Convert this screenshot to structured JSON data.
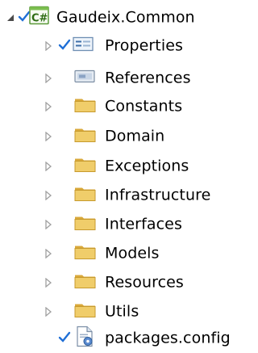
{
  "tree": {
    "project": {
      "name": "Gaudeix.Common",
      "expanded": true,
      "icon": "csharp-project-icon",
      "source_control": "checked-in"
    },
    "items": [
      {
        "label": "Properties",
        "icon": "properties-icon",
        "expandable": true,
        "source_control": "checked-in"
      },
      {
        "label": "References",
        "icon": "references-icon",
        "expandable": true
      },
      {
        "label": "Constants",
        "icon": "folder-icon",
        "expandable": true
      },
      {
        "label": "Domain",
        "icon": "folder-icon",
        "expandable": true
      },
      {
        "label": "Exceptions",
        "icon": "folder-icon",
        "expandable": true
      },
      {
        "label": "Infrastructure",
        "icon": "folder-icon",
        "expandable": true
      },
      {
        "label": "Interfaces",
        "icon": "folder-icon",
        "expandable": true
      },
      {
        "label": "Models",
        "icon": "folder-icon",
        "expandable": true
      },
      {
        "label": "Resources",
        "icon": "folder-icon",
        "expandable": true
      },
      {
        "label": "Utils",
        "icon": "folder-icon",
        "expandable": true
      },
      {
        "label": "packages.config",
        "icon": "config-file-icon",
        "expandable": false,
        "source_control": "checked-in"
      }
    ]
  },
  "colors": {
    "folder": "#e8c15a",
    "folder_dark": "#c79a2e",
    "check": "#1f6fd6",
    "expanded_arrow": "#4a4a4a",
    "collapsed_arrow": "#a0a0a0"
  }
}
